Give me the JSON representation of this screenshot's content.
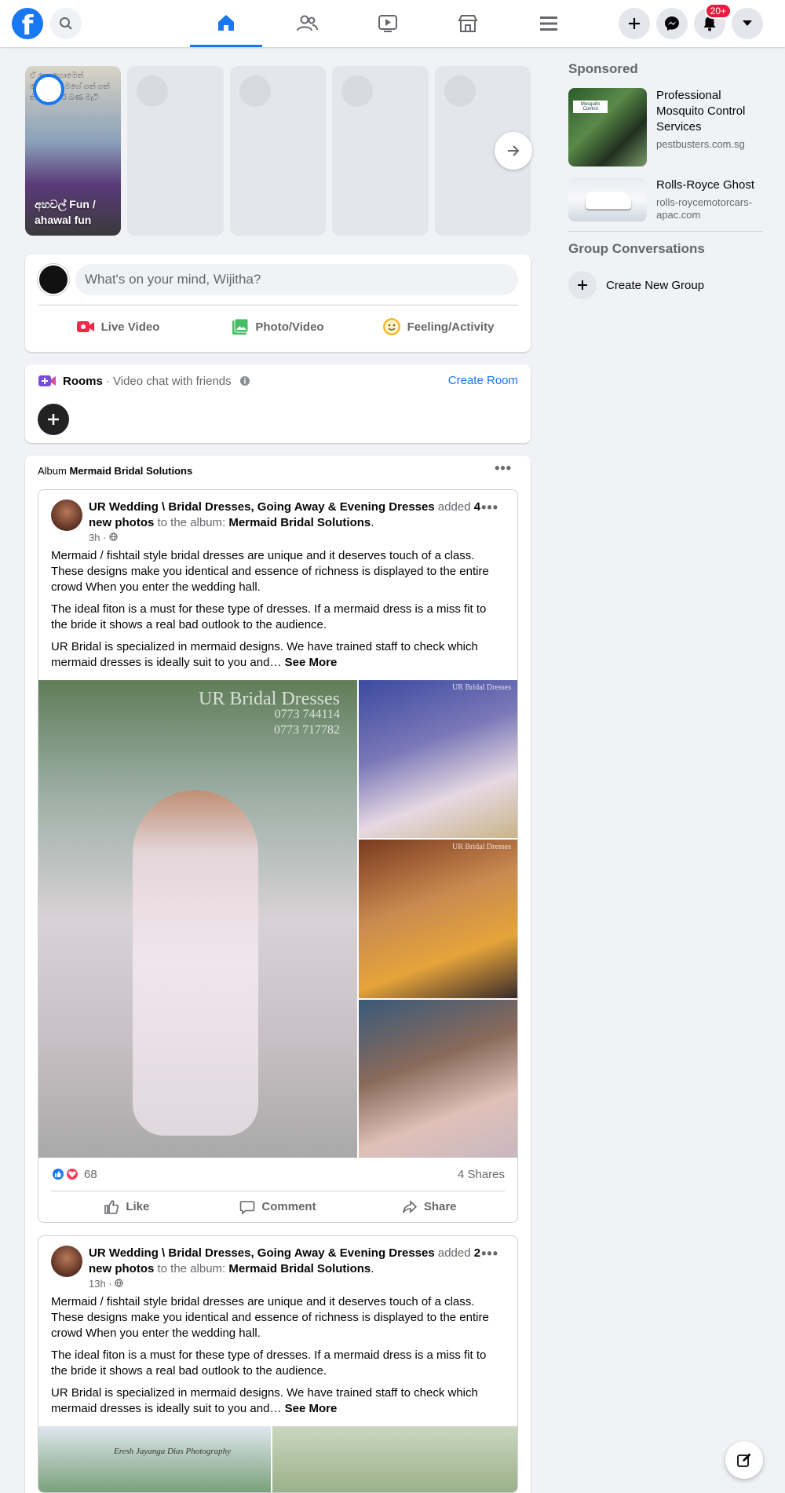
{
  "nav": {
    "notifications_badge": "20+",
    "accent": "#1877f2"
  },
  "stories": {
    "first_name": "අහවල් Fun / ahawal fun",
    "first_scribble": "ඒ කොහොමෙත් කොකටත් මගේ ගත් ගත් තීය වස්තර බණ මැටි"
  },
  "composer": {
    "placeholder": "What's on your mind, Wijitha?",
    "live_label": "Live Video",
    "photo_label": "Photo/Video",
    "feeling_label": "Feeling/Activity"
  },
  "rooms": {
    "title": "Rooms",
    "subtitle": "· Video chat with friends",
    "create_label": "Create Room"
  },
  "album": {
    "prefix": "Album",
    "name": "Mermaid Bridal Solutions"
  },
  "posts": [
    {
      "page": "UR Wedding \\ Bridal Dresses, Going Away & Evening Dresses",
      "added": "added",
      "count": "4 new photos",
      "to": "to the album:",
      "album": "Mermaid Bridal Solutions",
      "time": "3h",
      "para1": "Mermaid / fishtail style bridal dresses are unique and it deserves touch of a class. These designs make you identical and essence of richness is displayed to the entire crowd When you enter the wedding hall.",
      "para2": "The ideal fiton is a must for these type of dresses. If a mermaid dress is a miss fit to the bride it shows a real bad outlook to the audience.",
      "para3": "UR Bridal is specialized in mermaid designs. We have trained staff to check which mermaid dresses is ideally suit to you and…",
      "see_more": "See More",
      "watermark": "UR Bridal Dresses",
      "phone1": "0773 744114",
      "phone2": "0773 717782",
      "reactions": "68",
      "shares": "4 Shares",
      "like": "Like",
      "comment": "Comment",
      "share": "Share"
    },
    {
      "page": "UR Wedding \\ Bridal Dresses, Going Away & Evening Dresses",
      "added": "added",
      "count": "2 new photos",
      "to": "to the album:",
      "album": "Mermaid Bridal Solutions",
      "time": "13h",
      "para1": "Mermaid / fishtail style bridal dresses are unique and it deserves touch of a class. These designs make you identical and essence of richness is displayed to the entire crowd When you enter the wedding hall.",
      "para2": "The ideal fiton is a must for these type of dresses. If a mermaid dress is a miss fit to the bride it shows a real bad outlook to the audience.",
      "para3": "UR Bridal is specialized in mermaid designs. We have trained staff to check which mermaid dresses is ideally suit to you and…",
      "see_more": "See More",
      "photo_credit": "Eresh Jayanga Dias Photography"
    }
  ],
  "sidebar": {
    "sponsored": "Sponsored",
    "ads": [
      {
        "title": "Professional Mosquito Control Services",
        "url": "pestbusters.com.sg",
        "thumb_label": "Mosquito Control"
      },
      {
        "title": "Rolls-Royce Ghost",
        "url": "rolls-roycemotorcars-apac.com"
      }
    ],
    "group_heading": "Group Conversations",
    "create_group": "Create New Group"
  }
}
